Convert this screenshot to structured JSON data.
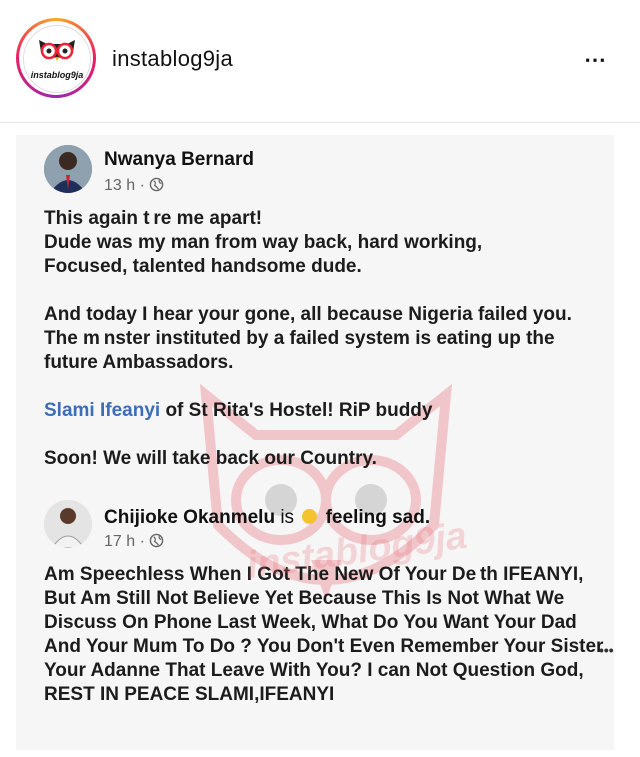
{
  "instagram": {
    "username": "instablog9ja",
    "avatar_label": "instablog9ja",
    "more_icon": "⋯"
  },
  "post1": {
    "author": "Nwanya Bernard",
    "meta": "13 h ·",
    "line1": "This again t re me apart!",
    "line2": "Dude was my man from way back, hard working,",
    "line3": "Focused, talented handsome dude.",
    "para2": "And today I hear your gone, all because Nigeria failed you. The m nster instituted by a failed system is eating up the future Ambassadors.",
    "tag_name": "Slami Ifeanyi",
    "tag_rest": " of St Rita's Hostel! RiP buddy",
    "closing": "Soon! We will take back our Country."
  },
  "post2": {
    "author": "Chijioke Okanmelu",
    "is": " is ",
    "feeling": " feeling sad.",
    "meta": "17 h ·",
    "more_icon": "•••",
    "body": "Am Speechless When I Got The New Of Your De th IFEANYI, But Am Still Not Believe Yet Because This Is Not What We Discuss On Phone Last Week, What Do You Want Your Dad And Your Mum To Do ? You Don't Even Remember Your Sister Your Adanne That Leave With You? I can Not Question God,",
    "last": "REST IN PEACE SLAMI,IFEANYI"
  },
  "watermark_text": "instablog9ja",
  "colors": {
    "link": "#3b6eb6",
    "watermark": "#e8707a"
  }
}
